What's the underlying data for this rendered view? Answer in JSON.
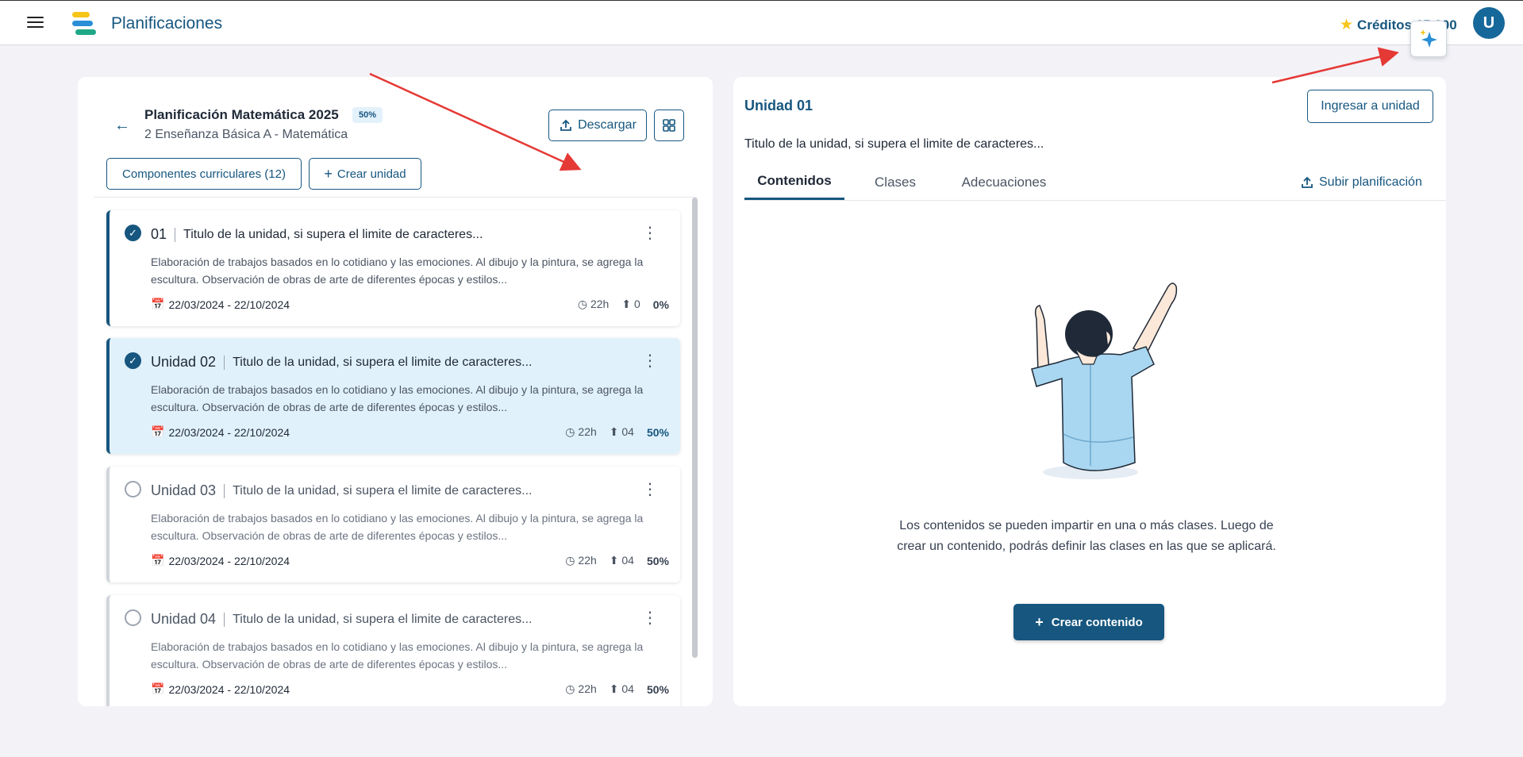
{
  "header": {
    "app_title": "Planificaciones",
    "credits_label": "Créditos 15.000",
    "avatar_initial": "U"
  },
  "plan": {
    "title": "Planificación Matemática 2025",
    "progress_badge": "50%",
    "subtitle": "2 Enseñanza Básica A - Matemática",
    "download_label": "Descargar",
    "components_label": "Componentes curriculares (12)",
    "create_unit_label": "Crear unidad"
  },
  "units": [
    {
      "number": "01",
      "title": "Titulo de la unidad, si supera el limite de caracteres...",
      "description": "Elaboración de trabajos basados en lo cotidiano y las emociones. Al dibujo y la pintura, se agrega la escultura. Observación de obras de arte de diferentes épocas y estilos...",
      "dates": "22/03/2024 - 22/10/2024",
      "hours": "22h",
      "uploads": "0",
      "percent": "0%",
      "completed": true
    },
    {
      "number": "Unidad 02",
      "title": "Titulo de la unidad, si supera el limite de caracteres...",
      "description": "Elaboración de trabajos basados en lo cotidiano y las emociones. Al dibujo y la pintura, se agrega la escultura. Observación de obras de arte de diferentes épocas y estilos...",
      "dates": "22/03/2024 - 22/10/2024",
      "hours": "22h",
      "uploads": "04",
      "percent": "50%",
      "completed": true
    },
    {
      "number": "Unidad 03",
      "title": "Titulo de la unidad, si supera el limite de caracteres...",
      "description": "Elaboración de trabajos basados en lo cotidiano y las emociones. Al dibujo y la pintura, se agrega la escultura. Observación de obras de arte de diferentes épocas y estilos...",
      "dates": "22/03/2024 - 22/10/2024",
      "hours": "22h",
      "uploads": "04",
      "percent": "50%",
      "completed": false
    },
    {
      "number": "Unidad 04",
      "title": "Titulo de la unidad, si supera el limite de caracteres...",
      "description": "Elaboración de trabajos basados en lo cotidiano y las emociones. Al dibujo y la pintura, se agrega la escultura. Observación de obras de arte de diferentes épocas y estilos...",
      "dates": "22/03/2024 - 22/10/2024",
      "hours": "22h",
      "uploads": "04",
      "percent": "50%",
      "completed": false
    }
  ],
  "detail": {
    "unit_label": "Unidad 01",
    "enter_label": "Ingresar a unidad",
    "unit_title": "Titulo de la unidad, si supera el limite de caracteres...",
    "tabs": [
      "Contenidos",
      "Clases",
      "Adecuaciones"
    ],
    "upload_label": "Subir planificación",
    "empty_message": "Los contenidos se pueden impartir en una o más clases. Luego de crear un contenido, podrás definir las clases en las que se aplicará.",
    "create_content_label": "Crear contenido"
  },
  "colors": {
    "primary": "#16567f",
    "selected_bg": "#e1f1fb",
    "annotation_arrow": "#e53935",
    "star": "#f5c518"
  }
}
